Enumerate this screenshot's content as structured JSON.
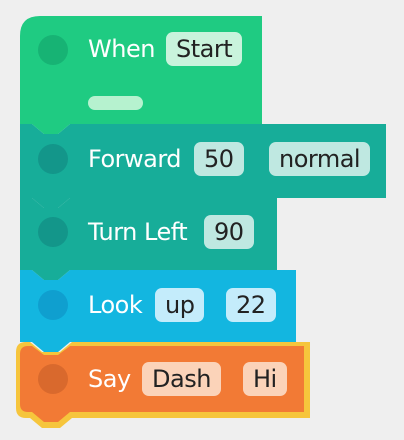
{
  "colors": {
    "background": "#efefef",
    "start_block": "#1fcb82",
    "drive_block": "#17ad99",
    "look_block": "#13b6e0",
    "say_block": "#f27a35",
    "selection_outline": "#f6c53c"
  },
  "blocks": [
    {
      "id": "when",
      "label": "When",
      "params": [
        "Start"
      ]
    },
    {
      "id": "forward",
      "label": "Forward",
      "params": [
        "50",
        "normal"
      ]
    },
    {
      "id": "turn-left",
      "label": "Turn Left",
      "params": [
        "90"
      ]
    },
    {
      "id": "look",
      "label": "Look",
      "params": [
        "up",
        "22"
      ]
    },
    {
      "id": "say",
      "label": "Say",
      "params": [
        "Dash",
        "Hi"
      ],
      "selected": true
    }
  ]
}
